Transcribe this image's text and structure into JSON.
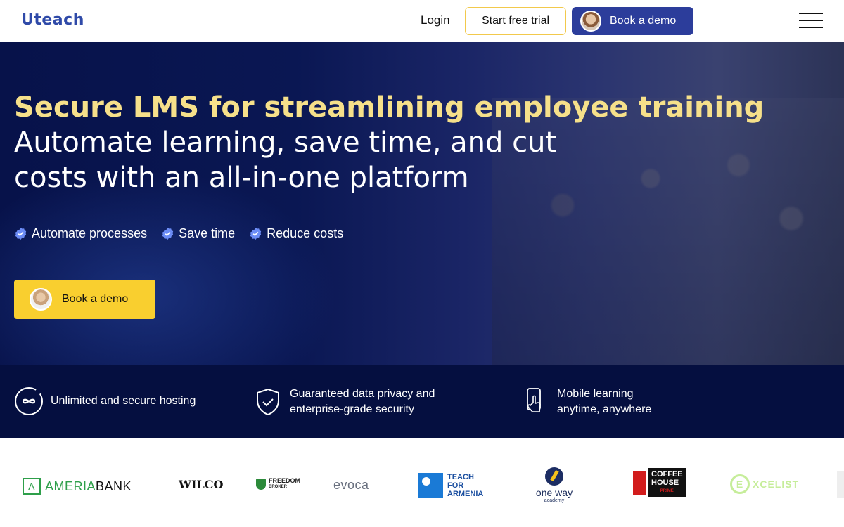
{
  "header": {
    "logo": "Uteach",
    "login": "Login",
    "start_trial": "Start free trial",
    "book_demo": "Book a demo"
  },
  "hero": {
    "title": "Secure LMS for streamlining employee training",
    "subtitle": "Automate learning, save time, and cut costs with an all-in-one platform",
    "checks": [
      "Automate processes",
      "Save time",
      "Reduce costs"
    ],
    "cta": "Book a demo"
  },
  "features": [
    {
      "icon": "infinity-hosting-icon",
      "lines": [
        "Unlimited and secure hosting"
      ]
    },
    {
      "icon": "shield-check-icon",
      "lines": [
        "Guaranteed data privacy and",
        "enterprise-grade security"
      ]
    },
    {
      "icon": "mobile-touch-icon",
      "lines": [
        "Mobile learning",
        "anytime, anywhere"
      ]
    }
  ],
  "logos": {
    "ameria": {
      "prefix": "AMERIA",
      "suffix": "BANK"
    },
    "wilco": "WILCO",
    "freedom": {
      "line1": "FREEDOM",
      "line2": "BROKER"
    },
    "evoca": "evoca",
    "teach": {
      "line1": "TEACH",
      "line2": "FOR",
      "line3": "ARMENIA"
    },
    "oneway": {
      "name": "one way",
      "sub": "academy"
    },
    "coffee": {
      "line1": "COFFEE",
      "line2": "HOUSE",
      "line3": "PRIME"
    },
    "xcelist": "XCELIST"
  },
  "colors": {
    "brand_blue": "#2c3d9b",
    "accent_yellow": "#f9cf2f",
    "hero_navy": "#07124a",
    "title_yellow": "#f6e08a"
  }
}
